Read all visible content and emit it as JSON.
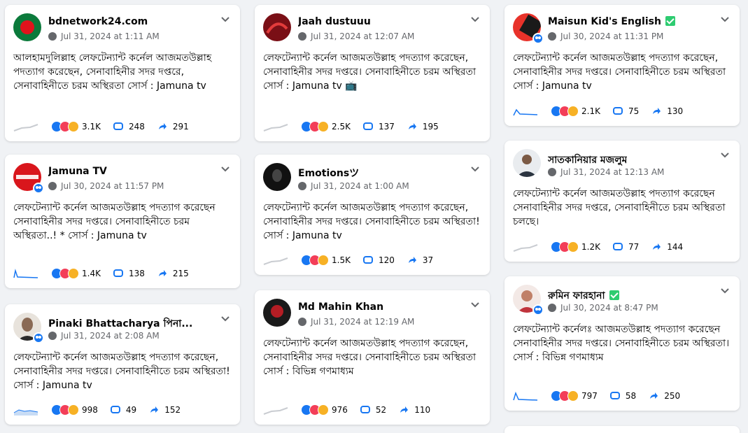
{
  "posts": [
    {
      "author": "bdnetwork24.com",
      "verified": false,
      "date": "Jul 31, 2024 at 1:11 AM",
      "text": "আলহামদুলিল্লাহ লেফটেন্যান্ট কর্নেল আজমতউল্লাহ পদত্যাগ করেছেন, সেনাবাহিনীর সদর দপ্তরে, সেনাবাহিনীতে চরম অস্থিরতা সোর্স : Jamuna tv",
      "reactions": "3.1K",
      "comments": "248",
      "shares": "291"
    },
    {
      "author": "Jamuna TV",
      "verified": false,
      "date": "Jul 30, 2024 at 11:57 PM",
      "text": "লেফটেন্যান্ট কর্নেল আজমতউল্লাহ পদত্যাগ করেছেন সেনাবাহিনীর সদর দপ্তরে। সেনাবাহিনীতে চরম অস্থিরতা..! * সোর্স : Jamuna tv",
      "reactions": "1.4K",
      "comments": "138",
      "shares": "215"
    },
    {
      "author": "Pinaki Bhattacharya পিনা...",
      "verified": false,
      "date": "Jul 31, 2024 at 2:08 AM",
      "text": "লেফটেন্যান্ট কর্নেল আজমতউল্লাহ পদত্যাগ করেছেন, সেনাবাহিনীর সদর দপ্তরে। সেনাবাহিনীতে চরম অস্থিরতা! সোর্স : Jamuna tv",
      "reactions": "998",
      "comments": "49",
      "shares": "152"
    },
    {
      "author": "Jaah dustuuu",
      "verified": false,
      "date": "Jul 31, 2024 at 12:07 AM",
      "text": "লেফটেন্যান্ট কর্নেল আজমতউল্লাহ পদত্যাগ করেছেন, সেনাবাহিনীর সদর দপ্তরে। সেনাবাহিনীতে চরম অস্থিরতা সোর্স : Jamuna tv 📺",
      "reactions": "2.5K",
      "comments": "137",
      "shares": "195"
    },
    {
      "author": "Emotionsツ",
      "verified": false,
      "date": "Jul 31, 2024 at 1:00 AM",
      "text": "লেফটেন্যান্ট কর্নেল আজমতউল্লাহ পদত্যাগ করেছেন, সেনাবাহিনীর সদর দপ্তরে। সেনাবাহিনীতে চরম অস্থিরতা! সোর্স : Jamuna tv",
      "reactions": "1.5K",
      "comments": "120",
      "shares": "37"
    },
    {
      "author": "Md Mahin Khan",
      "verified": false,
      "date": "Jul 31, 2024 at 12:19 AM",
      "text": "লেফটেন্যান্ট কর্নেল আজমতউল্লাহ পদত্যাগ করেছেন, সেনাবাহিনীর সদর দপ্তরে। সেনাবাহিনীতে চরম অস্থিরতা সোর্স : বিভিন্ন গণমাধ্যম",
      "reactions": "976",
      "comments": "52",
      "shares": "110"
    },
    {
      "author": "Maisun Kid's English",
      "verified": true,
      "date": "Jul 30, 2024 at 11:31 PM",
      "text": "লেফটেন্যান্ট কর্নেল আজমতউল্লাহ পদত্যাগ করেছেন, সেনাবাহিনীর সদর দপ্তরে। সেনাবাহিনীতে চরম অস্থিরতা সোর্স : Jamuna tv",
      "reactions": "2.1K",
      "comments": "75",
      "shares": "130"
    },
    {
      "author": "সাতকানিয়ার মজলুম",
      "verified": false,
      "date": "Jul 31, 2024 at 12:13 AM",
      "text": "লেফটেন্যান্ট কর্নেল আজমতউল্লাহ পদত্যাগ করেছেন সেনাবাহিনীর সদর দপ্তরে, সেনাবাহিনীতে চরম অস্থিরতা চলছে।",
      "reactions": "1.2K",
      "comments": "77",
      "shares": "144"
    },
    {
      "author": "রুমিন ফারহানা",
      "verified": true,
      "date": "Jul 30, 2024 at 8:47 PM",
      "text": "লেফটেন্যান্ট কর্নেলঃ আজমতউল্লাহ পদত্যাগ করেছেন সেনাবাহিনীর সদর দপ্তরে। সেনাবাহিনীতে চরম অস্থিরতা। সোর্স : বিভিন্ন গণমাধ্যম",
      "reactions": "797",
      "comments": "58",
      "shares": "250"
    }
  ],
  "colors": {
    "like": "#1877f2",
    "love": "#f33e58",
    "haha": "#f7b125",
    "accent": "#1877f2"
  },
  "icons": {
    "globe": "globe-icon",
    "more": "chevron-down-icon",
    "comment": "comment-icon",
    "share": "share-icon"
  }
}
